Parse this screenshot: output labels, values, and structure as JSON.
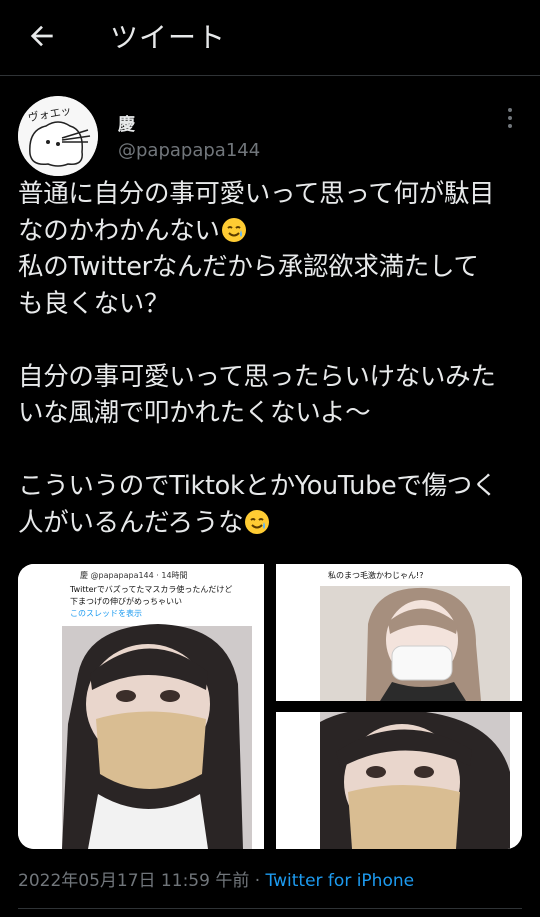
{
  "header": {
    "title": "ツイート"
  },
  "author": {
    "name": "慶",
    "handle": "@papapapa144",
    "avatar_text": "ヴォエッ"
  },
  "tweet": {
    "line1": "普通に自分の事可愛いって思って何が駄目",
    "line2": "なのかわかんない",
    "line3": "私のTwitterなんだから承認欲求満たして",
    "line4": "も良くない？",
    "line5": "自分の事可愛いって思ったらいけないみた",
    "line6": "いな風潮で叩かれたくないよ〜",
    "line7": "こういうのでTiktokとかYouTubeで傷つく",
    "line8": "人がいるんだろうな",
    "emoji": "tear-smile-emoji"
  },
  "media": {
    "img1": {
      "handle": "@papapapa144 · 14時間",
      "name": "慶",
      "text1": "Twitterでバズってたマスカラ使ったんだけど",
      "text2": "下まつげの伸びがめっちゃいい",
      "link": "このスレッドを表示"
    },
    "img2": {
      "text": "私のまつ毛激かわじゃん!?"
    }
  },
  "meta": {
    "date": "2022年05月17日 11:59 午前",
    "sep": " · ",
    "source": "Twitter for iPhone"
  }
}
